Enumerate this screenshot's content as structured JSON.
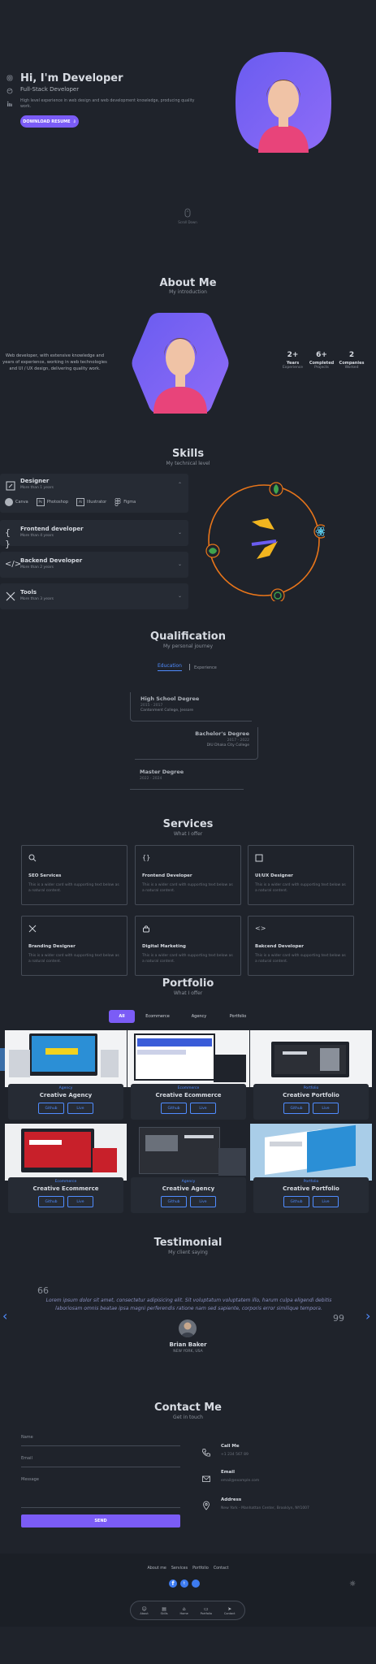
{
  "hero": {
    "title": "Hi, I'm Developer",
    "subtitle": "Full-Stack Developer",
    "description": "High level experience in web design and web development knowledge, producing quality work.",
    "cta_label": "DOWNLOAD RESUME",
    "scroll_label": "Scroll Down"
  },
  "about": {
    "title": "About Me",
    "subtitle": "My introduction",
    "text": "Web developer, with extensive knowledge and years of experience, working in web technologies and UI / UX design, delivering quality work.",
    "stats": [
      {
        "value": "2+",
        "label1": "Years",
        "label2": "Experience"
      },
      {
        "value": "6+",
        "label1": "Completed",
        "label2": "Projects"
      },
      {
        "value": "2",
        "label1": "Companies",
        "label2": "Worked"
      }
    ]
  },
  "skills": {
    "title": "Skills",
    "subtitle": "My technical level",
    "items": [
      {
        "title": "Designer",
        "sub": "More than 1 years",
        "tools": [
          "Canva",
          "Photoshop",
          "Illustrator",
          "Figma"
        ]
      },
      {
        "title": "Frontend developer",
        "sub": "More than 4 years"
      },
      {
        "title": "Backend Developer",
        "sub": "More than 2 years"
      },
      {
        "title": "Tools",
        "sub": "More than 3 years"
      }
    ]
  },
  "qualification": {
    "title": "Qualification",
    "subtitle": "My personal journey",
    "tabs": [
      "Education",
      "Experience"
    ],
    "items": [
      {
        "title": "High School Degree",
        "date": "2015 - 2017",
        "place": "Cantonment College, Jessore"
      },
      {
        "title": "Bachelor's Degree",
        "date": "2017 - 2022",
        "place": "DIU Dhaka City College"
      },
      {
        "title": "Master Degree",
        "date": "2022 - 2024",
        "place": ""
      }
    ]
  },
  "services": {
    "title": "Services",
    "subtitle": "What I offer",
    "items": [
      {
        "title": "SEO Services",
        "desc": "This is a wider card with supporting text below as a natural content."
      },
      {
        "title": "Frontend Developer",
        "desc": "This is a wider card with supporting text below as a natural content."
      },
      {
        "title": "UI/UX Designer",
        "desc": "This is a wider card with supporting text below as a natural content."
      },
      {
        "title": "Branding Designer",
        "desc": "This is a wider card with supporting text below as a natural content."
      },
      {
        "title": "Digital Marketing",
        "desc": "This is a wider card with supporting text below as a natural content."
      },
      {
        "title": "Bakcend Developer",
        "desc": "This is a wider card with supporting text below as a natural content."
      }
    ]
  },
  "portfolio": {
    "title": "Portfolio",
    "subtitle": "What I offer",
    "filters": [
      "All",
      "Ecommerce",
      "Agency",
      "Portfolio"
    ],
    "github_label": "Github",
    "live_label": "Live",
    "items": [
      {
        "category": "Agency",
        "name": "Creative Agency"
      },
      {
        "category": "Ecommerce",
        "name": "Creative Ecommerce"
      },
      {
        "category": "Portfolio",
        "name": "Creative Portfolio"
      },
      {
        "category": "Ecommerce",
        "name": "Creative Ecommerce"
      },
      {
        "category": "Agency",
        "name": "Creative Agency"
      },
      {
        "category": "Portfolio",
        "name": "Creative Portfolio"
      }
    ]
  },
  "testimonial": {
    "title": "Testimonial",
    "subtitle": "My client saying",
    "open_quote": "66",
    "close_quote": "99",
    "quote": "Lorem ipsum dolor sit amet, consectetur adipisicing elit. Sit voluptatum voluptatem illo, harum culpa eligendi debitis laboriosam omnis beatae ipsa magni perferendis ratione nam sed sapiente, corporis error similique tempora.",
    "name": "Brian Baker",
    "location": "NEW YORK, USA"
  },
  "contact": {
    "title": "Contact Me",
    "subtitle": "Get in touch",
    "name_label": "Name",
    "email_label": "Email",
    "message_label": "Message",
    "send_label": "SEND",
    "items": [
      {
        "title": "Call Me",
        "value": "+1 234 567 89"
      },
      {
        "title": "Email",
        "value": "email@example.com"
      },
      {
        "title": "Address",
        "value": "New York - Manhattan Center, Brooklyn, NY1007"
      }
    ]
  },
  "footer": {
    "links": [
      "About me",
      "Services",
      "Portfolio",
      "Contact"
    ],
    "nav": [
      "About",
      "Skills",
      "Home",
      "Portfolio",
      "Contact"
    ]
  },
  "colors": {
    "background": "#1f232b",
    "card": "#262b34",
    "accent": "#7b5cf6",
    "link": "#4f8cff",
    "skills_ring": "#e8751a"
  }
}
